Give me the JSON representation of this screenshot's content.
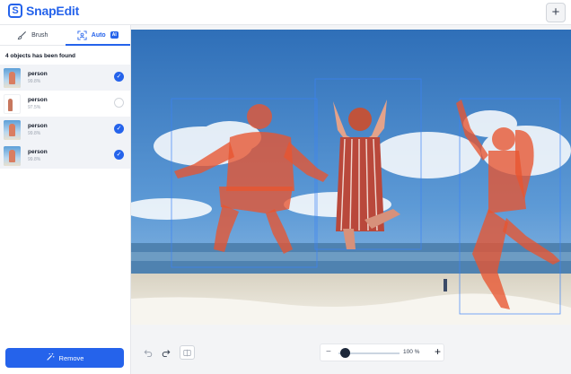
{
  "app": {
    "name": "SnapEdit",
    "logo_letter": "S",
    "new_button_label": "+"
  },
  "tabs": [
    {
      "label": "Brush",
      "icon": "brush-icon",
      "active": false
    },
    {
      "label": "Auto",
      "icon": "auto-detect-icon",
      "badge": "AI",
      "active": true
    }
  ],
  "objects": {
    "title": "4 objects has been found",
    "items": [
      {
        "name": "person",
        "score": "99.8%",
        "selected": true
      },
      {
        "name": "person",
        "score": "97.5%",
        "selected": false
      },
      {
        "name": "person",
        "score": "99.8%",
        "selected": true
      },
      {
        "name": "person",
        "score": "99.8%",
        "selected": true
      }
    ]
  },
  "actions": {
    "remove_label": "Remove"
  },
  "zoom": {
    "value_label": "100 %",
    "minus_label": "−",
    "plus_label": "+",
    "level": 1.0
  },
  "toolbar": {
    "undo_icon": "undo-icon",
    "redo_icon": "redo-icon",
    "compare_icon": "compare-icon"
  },
  "colors": {
    "accent": "#2563eb",
    "mask": "#e8552f"
  }
}
